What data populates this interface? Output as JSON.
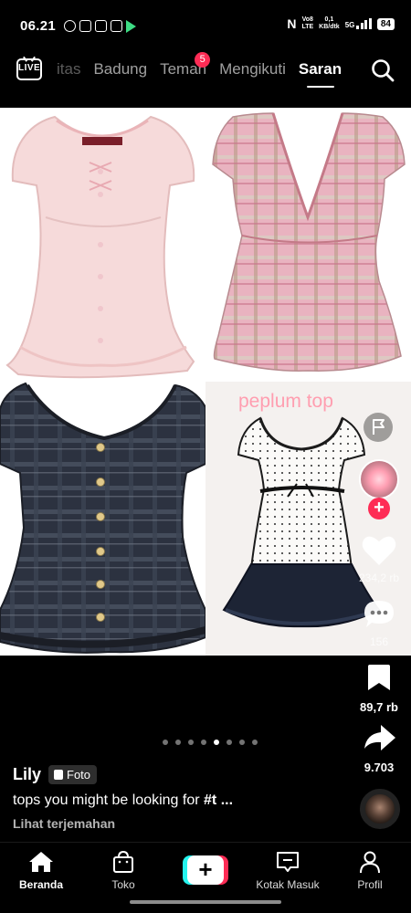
{
  "status_bar": {
    "time": "06.21",
    "net_lines": [
      "Vo8",
      "LTE"
    ],
    "speed_lines": [
      "0,1",
      "KB/dtk"
    ],
    "gen": "5G",
    "battery": "84"
  },
  "top_nav": {
    "live_label": "LIVE",
    "tabs": [
      {
        "label": "itas"
      },
      {
        "label": "Badung"
      },
      {
        "label": "Teman",
        "badge": "5"
      },
      {
        "label": "Mengikuti"
      },
      {
        "label": "Saran"
      }
    ]
  },
  "post": {
    "overlay_text": "peplum top",
    "actions": {
      "likes": "234,2 rb",
      "comments": "156",
      "bookmarks": "89,7 rb",
      "shares": "9.703"
    },
    "carousel_total": 8,
    "carousel_active": 5,
    "author": "Lily",
    "type_badge": "Foto",
    "caption_text": "tops you might be looking for ",
    "caption_tag": "#t ...",
    "translate_label": "Lihat terjemahan"
  },
  "bottom_nav": {
    "items": [
      {
        "label": "Beranda",
        "icon": "home-icon"
      },
      {
        "label": "Toko",
        "icon": "shop-bag-icon"
      },
      {
        "label": "Kotak Masuk",
        "icon": "inbox-icon"
      },
      {
        "label": "Profil",
        "icon": "profile-icon"
      }
    ]
  },
  "colors": {
    "accent": "#fe2c55",
    "cyan": "#25f4ee",
    "background": "#000000"
  }
}
